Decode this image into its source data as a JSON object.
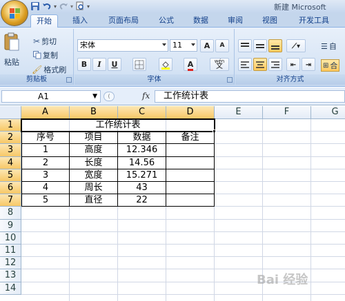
{
  "titlebar": {
    "title": "新建 Microsoft"
  },
  "tabs": [
    {
      "label": "开始",
      "active": true
    },
    {
      "label": "插入"
    },
    {
      "label": "页面布局"
    },
    {
      "label": "公式"
    },
    {
      "label": "数据"
    },
    {
      "label": "审阅"
    },
    {
      "label": "视图"
    },
    {
      "label": "开发工具"
    }
  ],
  "ribbon": {
    "clipboard": {
      "paste": "粘贴",
      "cut": "剪切",
      "copy": "复制",
      "format_painter": "格式刷",
      "group_label": "剪贴板"
    },
    "font": {
      "font_name": "宋体",
      "font_size": "11",
      "group_label": "字体",
      "bold": "B",
      "italic": "I",
      "underline": "U",
      "grow": "A",
      "shrink": "A",
      "font_color": "A",
      "wen": "wén",
      "wen_char": "文"
    },
    "alignment": {
      "group_label": "对齐方式",
      "wrap": "自",
      "merge": "合"
    }
  },
  "formula_bar": {
    "name_box": "A1",
    "fx": "fx",
    "formula": "工作统计表"
  },
  "sheet": {
    "columns": [
      "A",
      "B",
      "C",
      "D",
      "E",
      "F",
      "G"
    ],
    "rows": [
      "1",
      "2",
      "3",
      "4",
      "5",
      "6",
      "7",
      "8",
      "9",
      "10",
      "11",
      "12",
      "13",
      "14"
    ],
    "title": "工作统计表",
    "headers": [
      "序号",
      "项目",
      "数据",
      "备注"
    ],
    "data": [
      [
        "1",
        "高度",
        "12.346",
        ""
      ],
      [
        "2",
        "长度",
        "14.56",
        ""
      ],
      [
        "3",
        "宽度",
        "15.271",
        ""
      ],
      [
        "4",
        "周长",
        "43",
        ""
      ],
      [
        "5",
        "直径",
        "22",
        ""
      ]
    ]
  },
  "colors": {
    "accent": "#15428b",
    "selection": "#f7c867",
    "gridline": "#d0d7e5"
  },
  "watermark": "Bai 经验"
}
